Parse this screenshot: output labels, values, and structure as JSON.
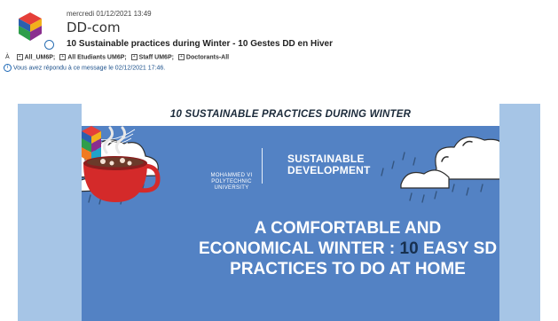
{
  "email": {
    "date": "mercredi 01/12/2021 13:49",
    "sender": "DD-com",
    "subject": "10 Sustainable practices during Winter - 10 Gestes DD en Hiver",
    "to_label": "À",
    "recipients": [
      "All_UM6P;",
      "All Etudiants UM6P;",
      "Staff UM6P;",
      "Doctorants-All"
    ],
    "info_message": "Vous avez répondu à ce message le 02/12/2021 17:46."
  },
  "newsletter": {
    "banner_title": "10 SUSTAINABLE PRACTICES DURING WINTER",
    "mvi_logo_text": "MOHAMMED VI POLYTECHNIC UNIVERSITY",
    "sd_logo_line1": "SUSTAINABLE",
    "sd_logo_line2": "DEVELOPMENT",
    "headline_part1": "A COMFORTABLE AND ECONOMICAL WINTER : ",
    "headline_number": "10",
    "headline_part2": " EASY SD PRACTICES TO DO AT HOME"
  },
  "colors": {
    "side_panel": "#a6c5e6",
    "hero_bg": "#5382c4",
    "headline": "#ffffff",
    "headline_number": "#17304f",
    "mug": "#d42a2a",
    "info_text": "#1a4f8a"
  },
  "icons": [
    "sender-logo-icon",
    "unread-radio-icon",
    "expand-icon",
    "info-icon",
    "cloud-icon",
    "rain-icon",
    "mug-icon"
  ]
}
